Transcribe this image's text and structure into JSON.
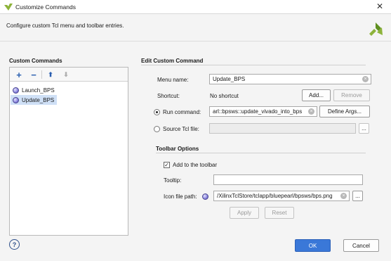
{
  "window": {
    "title": "Customize Commands"
  },
  "description": "Configure custom Tcl menu and toolbar entries.",
  "left_panel": {
    "title": "Custom Commands",
    "toolbar": [
      "+",
      "−",
      "⬆",
      "⬇"
    ],
    "items": [
      {
        "label": "Launch_BPS",
        "selected": false
      },
      {
        "label": "Update_BPS",
        "selected": true
      }
    ]
  },
  "edit": {
    "title": "Edit Custom Command",
    "menu_name_label": "Menu name:",
    "menu_name_value": "Update_BPS",
    "shortcut_label": "Shortcut:",
    "shortcut_value": "No shortcut",
    "add_label": "Add...",
    "remove_label": "Remove",
    "run_command_label": "Run command:",
    "run_command_value": "arl::bpsws::update_vivado_into_bps",
    "define_args_label": "Define Args...",
    "source_tcl_label": "Source Tcl file:",
    "browse_label": "..."
  },
  "toolbar_options": {
    "title": "Toolbar Options",
    "add_to_toolbar_label": "Add to the toolbar",
    "add_to_toolbar_checked": true,
    "tooltip_label": "Tooltip:",
    "icon_path_label": "Icon file path:",
    "icon_path_value": "/XilinxTclStore/tclapp/bluepearl/bpsws/bps.png",
    "browse_label": "...",
    "apply_label": "Apply",
    "reset_label": "Reset"
  },
  "footer": {
    "help": "?",
    "ok_label": "OK",
    "cancel_label": "Cancel"
  },
  "colors": {
    "accent": "#3a78d8",
    "selection": "#cfe0f6",
    "logo_green": "#8db33a"
  }
}
